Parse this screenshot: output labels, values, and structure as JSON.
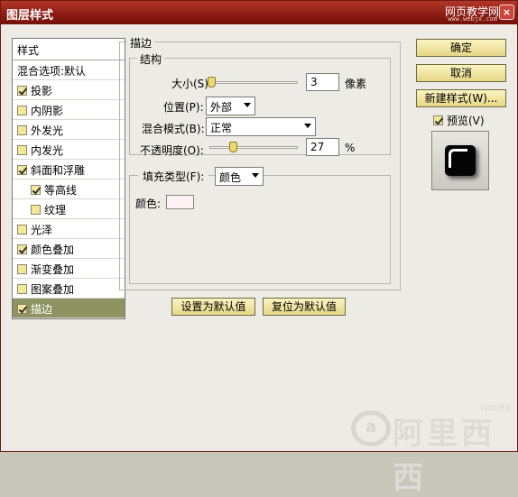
{
  "window": {
    "title": "图层样式",
    "watermark": "网页教学网",
    "watermark_url": "www.webjx.com",
    "close_glyph": "×"
  },
  "style_list": {
    "header": "样式",
    "blend_options": "混合选项:默认",
    "items": [
      {
        "label": "投影",
        "checked": true
      },
      {
        "label": "内阴影",
        "checked": false
      },
      {
        "label": "外发光",
        "checked": false
      },
      {
        "label": "内发光",
        "checked": false
      },
      {
        "label": "斜面和浮雕",
        "checked": true
      },
      {
        "label": "等高线",
        "checked": true,
        "sub": true
      },
      {
        "label": "纹理",
        "checked": false,
        "sub": true
      },
      {
        "label": "光泽",
        "checked": false
      },
      {
        "label": "颜色叠加",
        "checked": true
      },
      {
        "label": "渐变叠加",
        "checked": false
      },
      {
        "label": "图案叠加",
        "checked": false
      },
      {
        "label": "描边",
        "checked": true,
        "selected": true
      }
    ]
  },
  "stroke": {
    "group_label": "描边",
    "structure": {
      "label": "结构",
      "size_label": "大小(S):",
      "size_value": "3",
      "size_unit": "像素",
      "size_fraction": 0.01,
      "position_label": "位置(P):",
      "position_value": "外部",
      "blend_label": "混合模式(B):",
      "blend_value": "正常",
      "opacity_label": "不透明度(O):",
      "opacity_value": "27",
      "opacity_unit": "%",
      "opacity_percent": 27
    },
    "fill": {
      "type_label": "填充类型(F):",
      "type_value": "颜色",
      "color_label": "颜色:",
      "color_hex": "#fff2f2"
    },
    "set_default_button": "设置为默认值",
    "reset_default_button": "复位为默认值"
  },
  "right_panel": {
    "ok_button": "确定",
    "cancel_button": "取消",
    "new_style_button": "新建样式(W)...",
    "preview_label": "预览(V)",
    "preview_checked": true
  },
  "watermark": {
    "logo_letter": "a",
    "text": "阿里西西",
    "tag": "WEB开发"
  },
  "colors": {
    "title_bar": "#8d1d14",
    "selection": "#8d9462",
    "dialog_bg": "#ecebe5"
  }
}
